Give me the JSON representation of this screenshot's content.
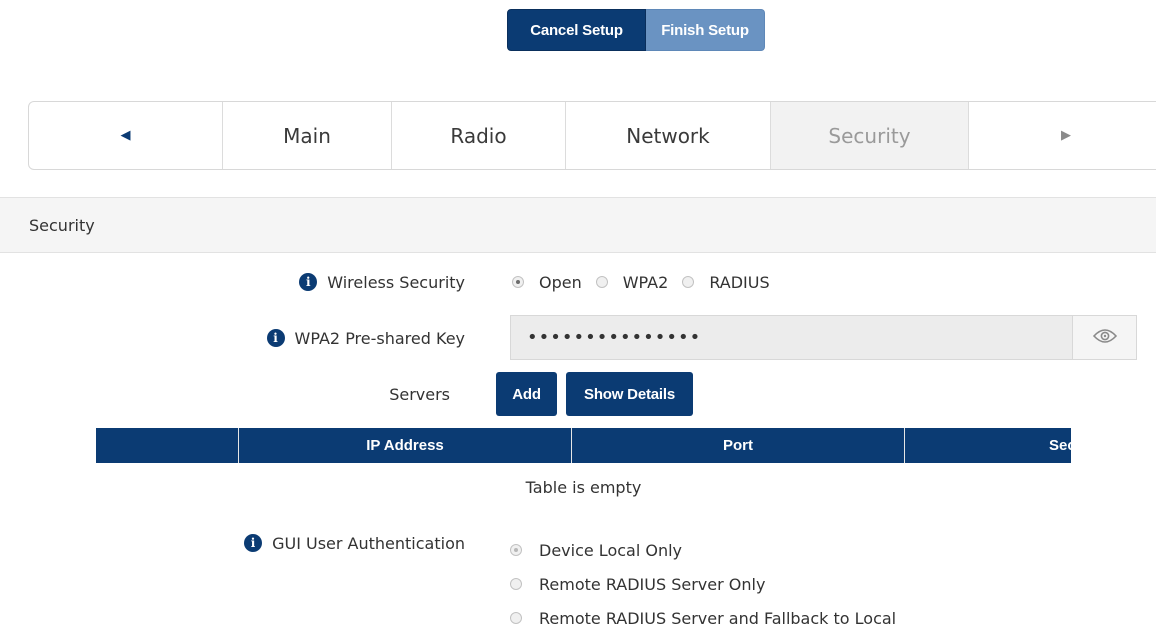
{
  "header": {
    "cancel_label": "Cancel Setup",
    "finish_label": "Finish Setup"
  },
  "tabs": {
    "prev_icon": "◀",
    "next_icon": "▶",
    "items": [
      {
        "label": "Main",
        "active": false
      },
      {
        "label": "Radio",
        "active": false
      },
      {
        "label": "Network",
        "active": false
      },
      {
        "label": "Security",
        "active": true
      }
    ]
  },
  "section": {
    "title": "Security",
    "wireless_security": {
      "label": "Wireless Security",
      "options": [
        "Open",
        "WPA2",
        "RADIUS"
      ],
      "selected": "Open"
    },
    "psk": {
      "label": "WPA2 Pre-shared Key",
      "value": "•••••••••••••••"
    },
    "servers": {
      "label": "Servers",
      "add_label": "Add",
      "details_label": "Show Details",
      "columns": [
        "",
        "IP Address",
        "Port",
        "Sec"
      ],
      "empty_text": "Table is empty"
    },
    "gui_auth": {
      "label": "GUI User Authentication",
      "options": [
        "Device Local Only",
        "Remote RADIUS Server Only",
        "Remote RADIUS Server and Fallback to Local"
      ],
      "selected": "Device Local Only"
    }
  },
  "colors": {
    "primary": "#0b3b73",
    "secondary_button": "#6a93c2",
    "section_bg": "#f5f5f5"
  },
  "icons": {
    "info": "info-icon",
    "eye": "eye-icon",
    "prev": "caret-left-icon",
    "next": "caret-right-icon"
  }
}
